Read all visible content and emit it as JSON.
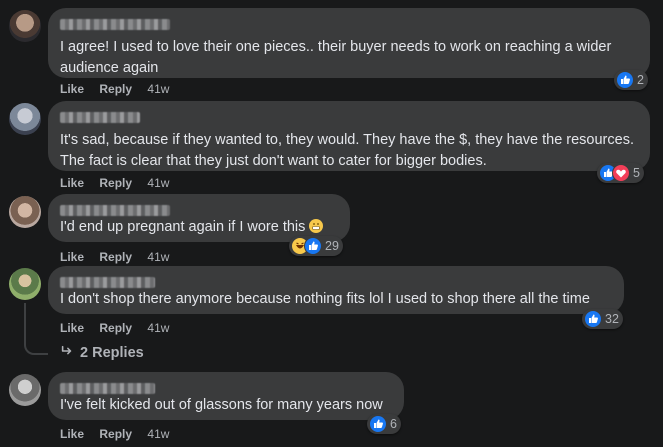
{
  "comments": [
    {
      "text": "I agree! I used to love their one pieces.. their buyer needs to work on reaching a wider audience again",
      "like": "Like",
      "reply": "Reply",
      "time": "41w",
      "reaction_count": "2"
    },
    {
      "text": "It's sad, because if they wanted to, they would. They have the $, they have the resources. The fact is clear that they just don't want to cater for bigger bodies.",
      "like": "Like",
      "reply": "Reply",
      "time": "41w",
      "reaction_count": "5"
    },
    {
      "text": "I'd end up pregnant again if I wore this",
      "like": "Like",
      "reply": "Reply",
      "time": "41w",
      "reaction_count": "29"
    },
    {
      "text": "I don't shop there anymore because nothing fits lol I used to shop there all the time",
      "like": "Like",
      "reply": "Reply",
      "time": "41w",
      "reaction_count": "32",
      "replies_label": "2 Replies"
    },
    {
      "text": "I've felt kicked out of glassons for many years now",
      "like": "Like",
      "reply": "Reply",
      "time": "41w",
      "reaction_count": "6"
    }
  ],
  "colors": {
    "background": "#18191a",
    "bubble": "#3a3b3c",
    "like_blue": "#1877f2",
    "love_red": "#f33e58",
    "haha_yellow": "#f7c84b"
  }
}
